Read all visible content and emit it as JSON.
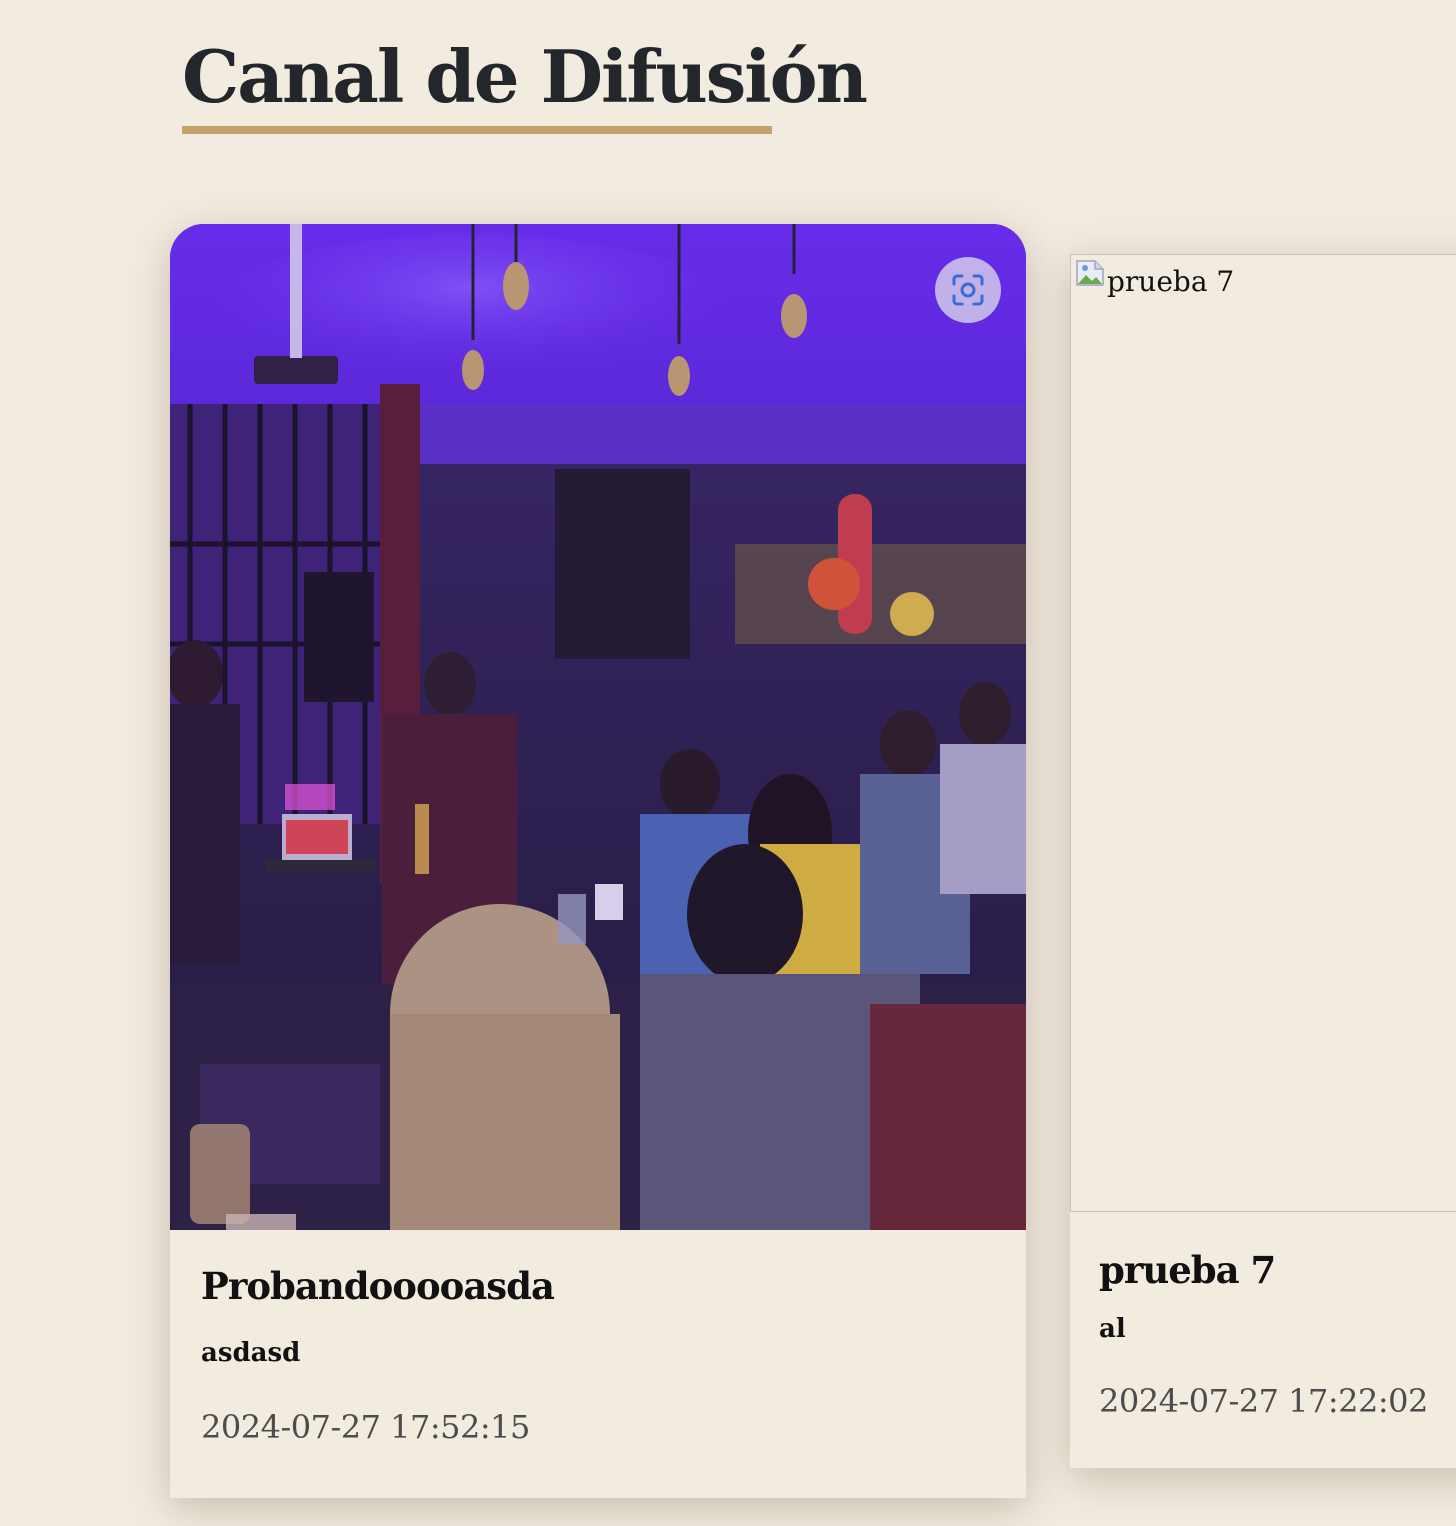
{
  "page": {
    "title": "Canal de Difusión"
  },
  "posts": [
    {
      "title": "Probandooooasda",
      "description": "asdasd",
      "date": "2024-07-27 17:52:15",
      "image_alt": "Probandooooasda",
      "image_icon": "live-music-photo",
      "lens_icon": "visual-search-icon"
    },
    {
      "title": "prueba 7",
      "description": "al",
      "date": "2024-07-27 17:22:02",
      "image_alt": "prueba 7",
      "image_icon": "broken-image-icon"
    }
  ],
  "colors": {
    "background": "#f2ebe0",
    "accent_underline": "#c3a26c",
    "title_text": "#23272c",
    "date_text": "#4c4c4c",
    "photo_purple": "#6a2ef0"
  }
}
